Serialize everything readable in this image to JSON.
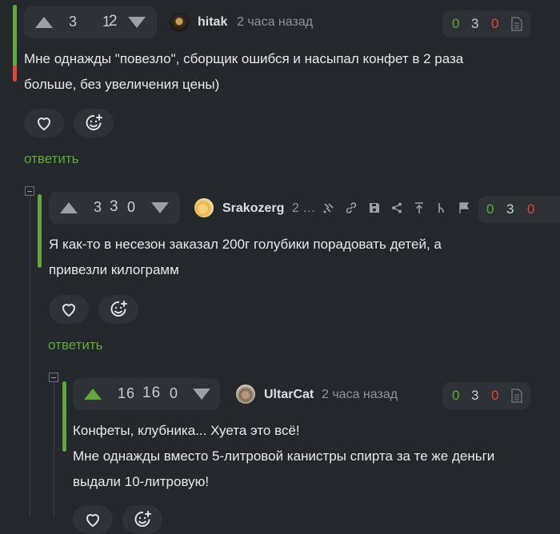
{
  "comments": [
    {
      "votes": {
        "plus": "3",
        "total": "2",
        "minus": "1"
      },
      "author": "hitak",
      "time": "2 часа назад",
      "stats": {
        "plus": "0",
        "mid": "3",
        "minus": "0"
      },
      "lines": [
        "Мне однажды \"повезло\", сборщик ошибся и насыпал конфет в 2 раза",
        "больше, без увеличения цены)"
      ],
      "reply": "ответить"
    },
    {
      "votes": {
        "plus": "3",
        "total": "3",
        "minus": "0"
      },
      "author": "Srakozerg",
      "time": "2 …",
      "stats": {
        "plus": "0",
        "mid": "3",
        "minus": "0"
      },
      "lines": [
        "Я как-то в несезон заказал 200г голубики порадовать детей, а",
        "привезли килограмм"
      ],
      "reply": "ответить"
    },
    {
      "votes": {
        "plus": "16",
        "total": "16",
        "minus": "0"
      },
      "author": "UltarCat",
      "time": "2 часа назад",
      "stats": {
        "plus": "0",
        "mid": "3",
        "minus": "0"
      },
      "lines": [
        "Конфеты, клубника... Хуета это всё!",
        "Мне однажды вместо 5-литровой канистры спирта за те же деньги",
        "выдали 10-литровую!"
      ]
    }
  ],
  "icons": [
    "arrow-up-icon",
    "arrow-down-icon",
    "heart-icon",
    "emoji-plus-icon",
    "document-icon",
    "comments-branch-icon",
    "link-icon",
    "save-icon",
    "share-icon",
    "up-arrow-icon",
    "hierarchy-icon",
    "flag-icon"
  ],
  "colors": {
    "bg": "#24272b",
    "panel": "#2e3237",
    "green": "#5fa839",
    "red": "#e0453a",
    "accent_bar_red": "#e0453a"
  }
}
